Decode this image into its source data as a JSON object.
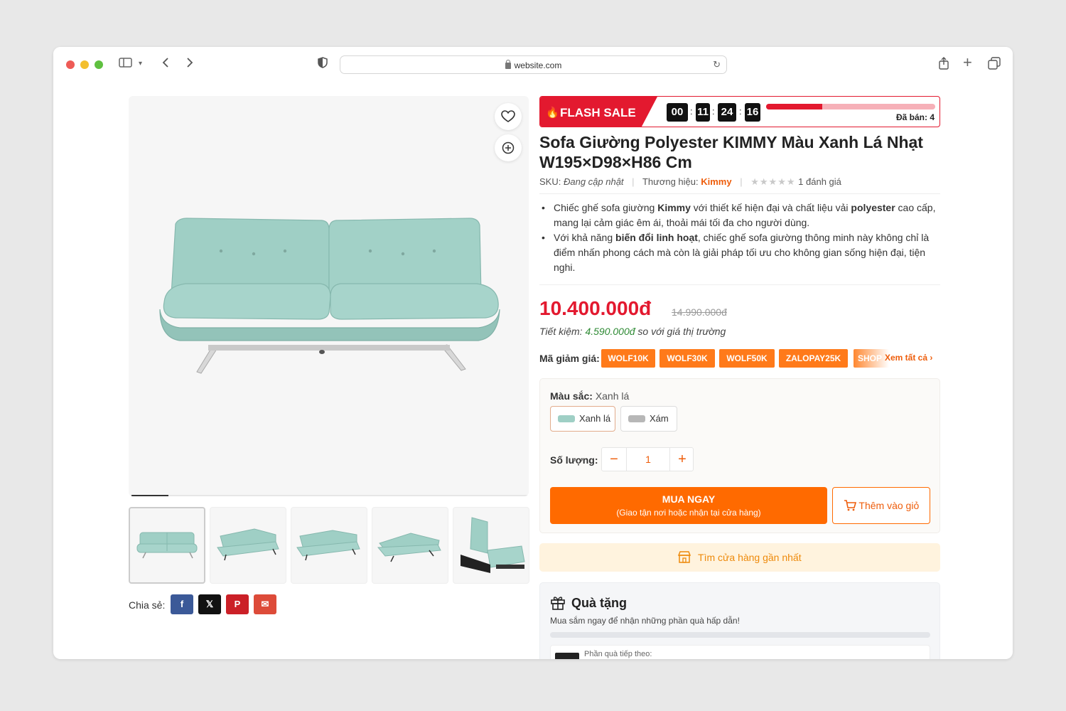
{
  "browser": {
    "url": "website.com"
  },
  "gallery": {
    "thumb_count": 5,
    "share_label": "Chia sẻ:",
    "share_buttons": [
      {
        "name": "facebook",
        "glyph": "f",
        "color": "#3b5998"
      },
      {
        "name": "x",
        "glyph": "𝕏",
        "color": "#111111"
      },
      {
        "name": "pinterest",
        "glyph": "P",
        "color": "#cb2027"
      },
      {
        "name": "email",
        "glyph": "✉",
        "color": "#dd4b39"
      }
    ]
  },
  "flash_sale": {
    "label": "FLASH SALE",
    "countdown": [
      "00",
      "11",
      "24",
      "16"
    ],
    "sold_label": "Đã bán: 4",
    "sold_progress": 0.33
  },
  "product": {
    "title": "Sofa Giường Polyester KIMMY Màu Xanh Lá Nhạt W195×D98×H86 Cm",
    "sku_label": "SKU:",
    "sku_value": "Đang cập nhật",
    "brand_label": "Thương hiệu:",
    "brand_value": "Kimmy",
    "rating_stars": "★★★★★",
    "rating_text": "1 đánh giá",
    "desc1_a": "Chiếc ghế sofa giường ",
    "desc1_b": "Kimmy",
    "desc1_c": " với thiết kế hiện đại và chất liệu vải ",
    "desc1_d": "polyester",
    "desc1_e": " cao cấp, mang lại cảm giác êm ái, thoải mái tối đa cho người dùng.",
    "desc2_a": "Với khả năng ",
    "desc2_b": "biến đổi linh hoạt",
    "desc2_c": ", chiếc ghế sofa giường thông minh này không chỉ là điểm nhấn phong cách mà còn là giải pháp tối ưu cho không gian sống hiện đại, tiện nghi."
  },
  "pricing": {
    "price": "10.400.000đ",
    "old_price": "14.990.000đ",
    "saving_prefix": "Tiết kiệm: ",
    "saving_amount": "4.590.000đ",
    "saving_suffix": " so với giá thị trường"
  },
  "coupons": {
    "label": "Mã giảm giá:",
    "items": [
      "WOLF10K",
      "WOLF30K",
      "WOLF50K",
      "ZALOPAY25K"
    ],
    "truncated": "SHOP",
    "see_all": "Xem tất cả"
  },
  "options": {
    "color_label": "Màu sắc:",
    "color_value": "Xanh lá",
    "swatches": [
      {
        "label": "Xanh lá",
        "color": "#9fcfc5"
      },
      {
        "label": "Xám",
        "color": "#b7b7b7"
      }
    ],
    "qty_label": "Số lượng:",
    "qty_value": "1",
    "buy_now": "MUA NGAY",
    "buy_now_sub": "(Giao tận nơi hoặc nhận tại cửa hàng)",
    "add_to_cart": "Thêm vào giỏ"
  },
  "store": {
    "label": "Tìm cửa hàng gần nhất"
  },
  "gift": {
    "title": "Quà tặng",
    "subtitle": "Mua sắm ngay để nhận những phần quà hấp dẫn!",
    "next_label": "Phần quà tiếp theo:"
  },
  "colors": {
    "accent": "#ff6a00",
    "price_red": "#e3192f",
    "sofa": "#9fcfc5"
  }
}
